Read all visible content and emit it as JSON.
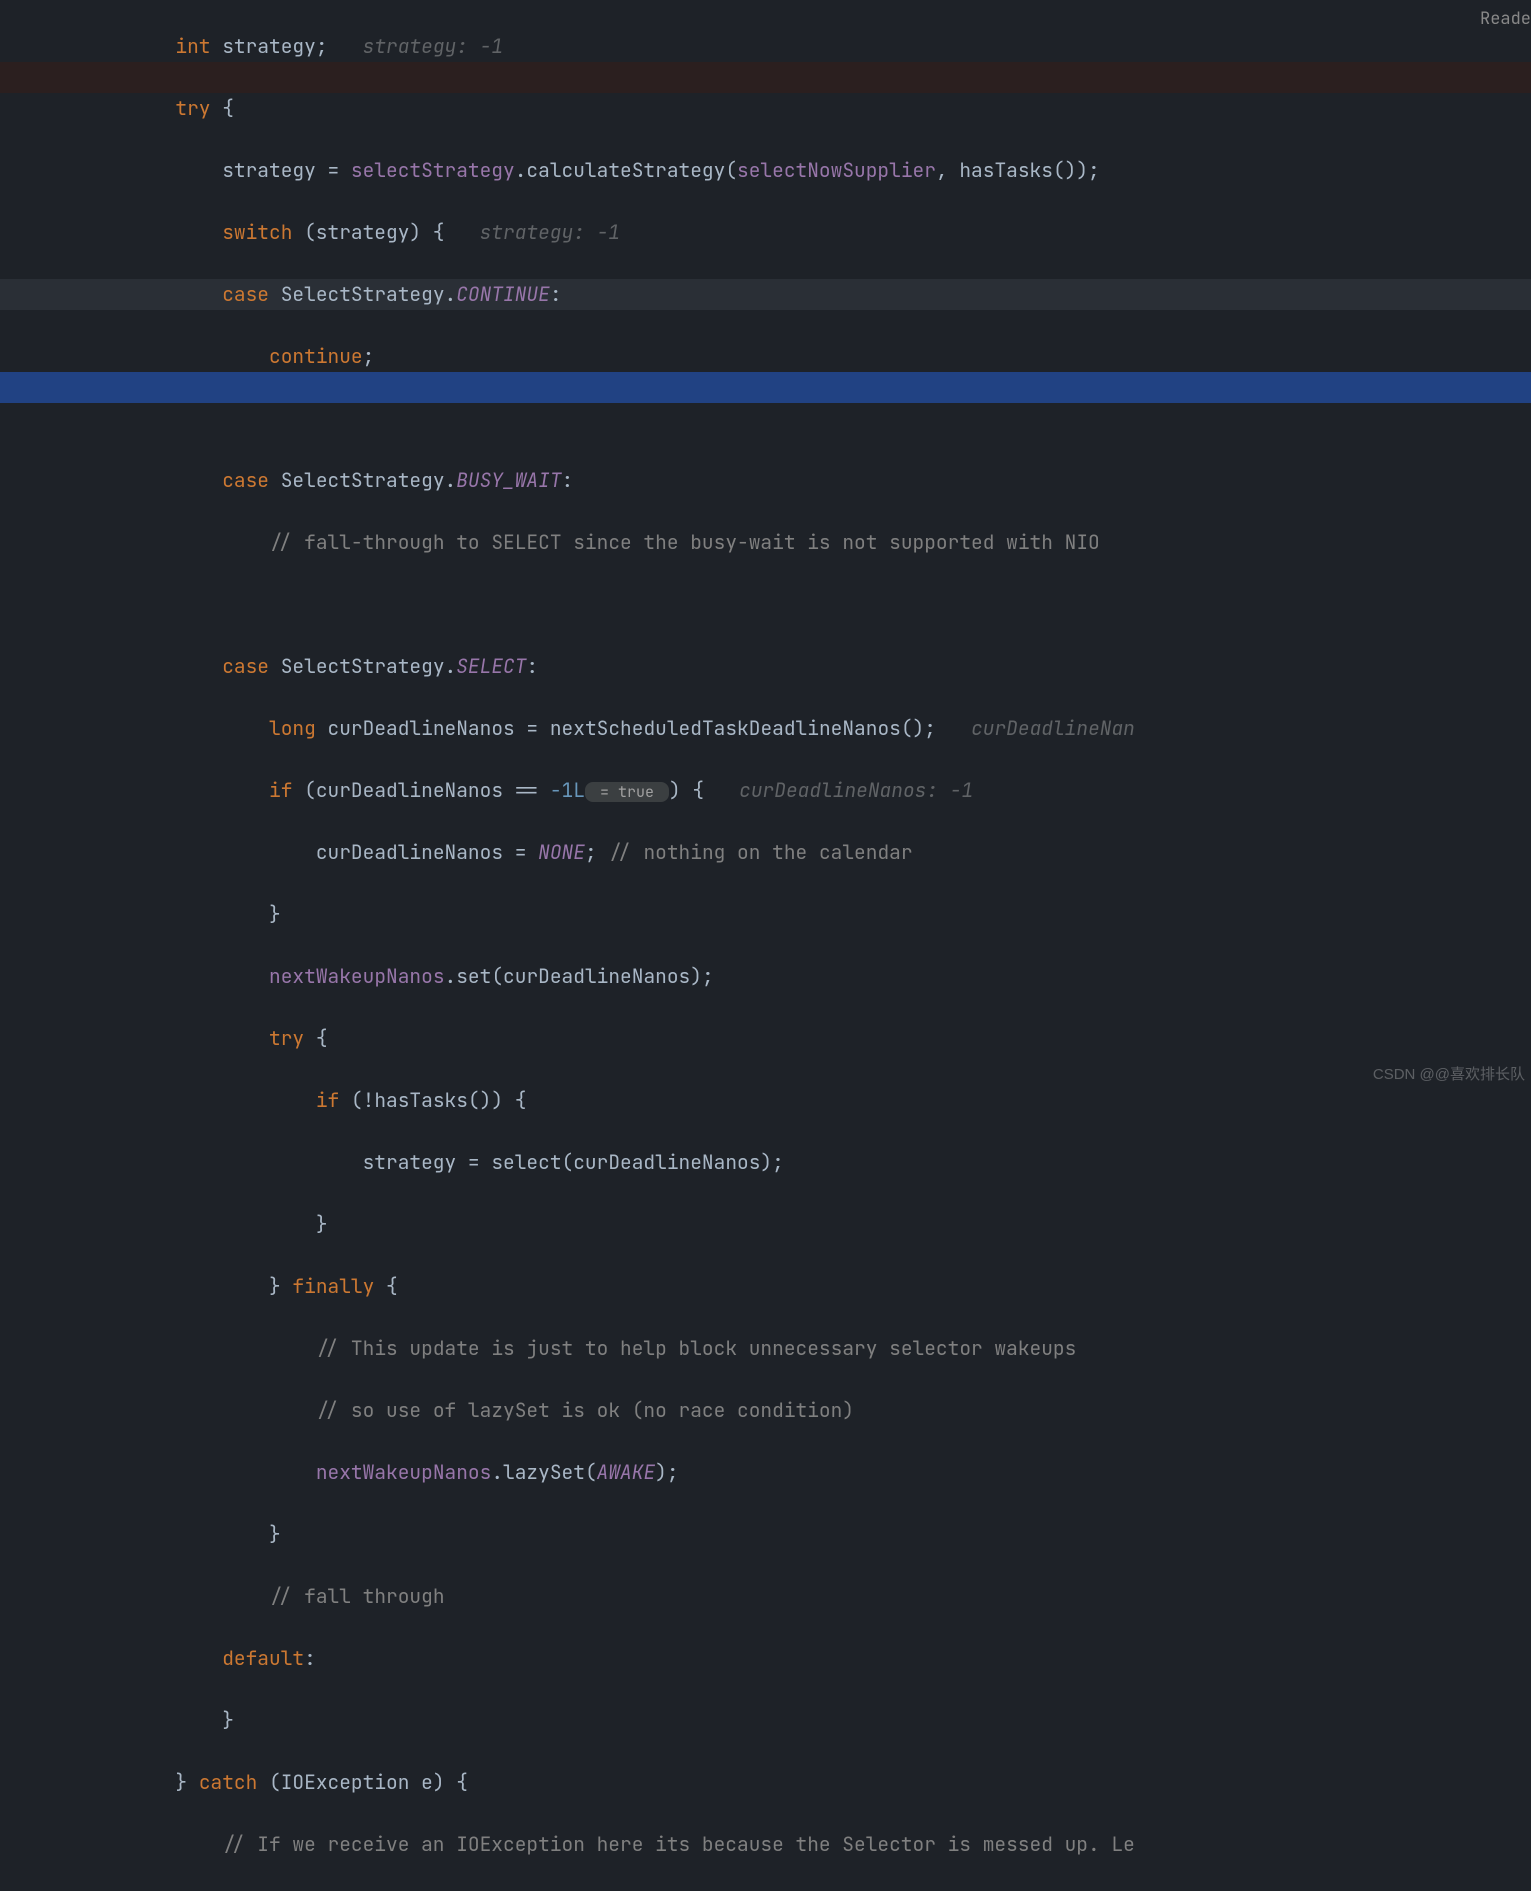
{
  "topRight": "Reade",
  "watermark": "CSDN @@喜欢排长队",
  "debugChip": " = true ",
  "hints": {
    "strategy1": "strategy: -1",
    "strategy2": "strategy: -1",
    "curDeadlineHint": "curDeadlineNanos: -1",
    "curDeadlineDecl": "curDeadlineNan"
  },
  "code": {
    "l1_int": "int",
    "l1_strategy": " strategy;   ",
    "l2_try": "try",
    "l2_brace": " {",
    "l3_assign_lhs": "strategy = ",
    "l3_field": "selectStrategy",
    "l3_dot": ".",
    "l3_method": "calculateStrategy",
    "l3_open": "(",
    "l3_arg1": "selectNowSupplier",
    "l3_comma": ", ",
    "l3_call2": "hasTasks",
    "l3_close": "());",
    "l4_switch": "switch",
    "l4_rest": " (strategy) {   ",
    "l5_case": "case",
    "l5_rest": " SelectStrategy.",
    "l5_const": "CONTINUE",
    "l5_colon": ":",
    "l6_continue": "continue",
    "l6_semi": ";",
    "l8_case": "case",
    "l8_rest": " SelectStrategy.",
    "l8_const": "BUSY_WAIT",
    "l8_colon": ":",
    "l9_comment": "// fall-through to SELECT since the busy-wait is not supported with NIO",
    "l11_case": "case",
    "l11_rest": " SelectStrategy.",
    "l11_const": "SELECT",
    "l11_colon": ":",
    "l12_long": "long",
    "l12_var": " curDeadlineNanos = ",
    "l12_call": "nextScheduledTaskDeadlineNanos",
    "l12_end": "();   ",
    "l13_if": "if",
    "l13_cond1": " (curDeadlineNanos == ",
    "l13_num": "-1L",
    "l13_cond2": ") {   ",
    "l14_lhs": "curDeadlineNanos = ",
    "l14_const": "NONE",
    "l14_semi": "; ",
    "l14_comment": "// nothing on the calendar",
    "l15_brace": "}",
    "l16_field": "nextWakeupNanos",
    "l16_dot": ".",
    "l16_method": "set",
    "l16_args": "(curDeadlineNanos);",
    "l17_try": "try",
    "l17_brace": " {",
    "l18_if": "if",
    "l18_rest": " (!hasTasks()) {",
    "l19_lhs": "strategy = ",
    "l19_method": "select",
    "l19_args": "(curDeadlineNanos);",
    "l20_brace": "}",
    "l21_close": "} ",
    "l21_finally": "finally",
    "l21_brace": " {",
    "l22_comment": "// This update is just to help block unnecessary selector wakeups",
    "l23_comment": "// so use of lazySet is ok (no race condition)",
    "l24_field": "nextWakeupNanos",
    "l24_dot": ".",
    "l24_method": "lazySet",
    "l24_open": "(",
    "l24_const": "AWAKE",
    "l24_close": ");",
    "l25_brace": "}",
    "l26_comment": "// fall through",
    "l27_default": "default",
    "l27_colon": ":",
    "l28_brace": "}",
    "l29_close": "} ",
    "l29_catch": "catch",
    "l29_rest": " (IOException e) {",
    "l30_comment": "// If we receive an IOException here its because the Selector is messed up. Le"
  },
  "indent": {
    "i4": "            ",
    "i5": "                ",
    "i6": "                    ",
    "i7": "                        ",
    "i8": "                            "
  }
}
